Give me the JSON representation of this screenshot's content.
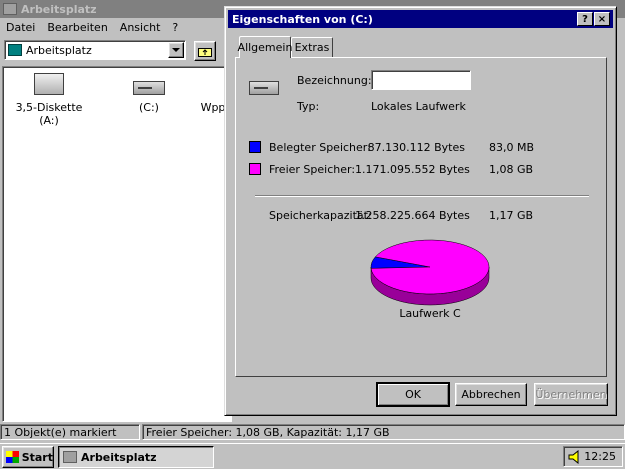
{
  "explorer": {
    "title": "Arbeitsplatz",
    "menu": [
      "Datei",
      "Bearbeiten",
      "Ansicht",
      "?"
    ],
    "address": "Arbeitsplatz",
    "items": [
      {
        "label": "3,5-Diskette (A:)",
        "icon": "floppy-drive-icon"
      },
      {
        "label": "(C:)",
        "icon": "hard-drive-icon"
      },
      {
        "label": "Wpp",
        "icon": "hard-drive-icon"
      }
    ],
    "status": {
      "left": "1 Objekt(e) markiert",
      "right": "Freier Speicher: 1,08 GB, Kapazität: 1,17 GB"
    }
  },
  "dialog": {
    "title": "Eigenschaften von  (C:)",
    "help_btn": "?",
    "close_btn": "×",
    "tabs": [
      "Allgemein",
      "Extras"
    ],
    "label_name": "Bezeichnung:",
    "name_value": "",
    "label_type": "Typ:",
    "type_value": "Lokales Laufwerk",
    "used": {
      "label": "Belegter Speicher:",
      "bytes": "87.130.112 Bytes",
      "size": "83,0 MB",
      "color": "#0000ff"
    },
    "free": {
      "label": "Freier Speicher:",
      "bytes": "1.171.095.552 Bytes",
      "size": "1,08 GB",
      "color": "#ff00ff"
    },
    "capacity": {
      "label": "Speicherkapazität:",
      "bytes": "1.258.225.664 Bytes",
      "size": "1,17 GB"
    },
    "drive_caption": "Laufwerk C",
    "buttons": {
      "ok": "OK",
      "cancel": "Abbrechen",
      "apply": "Übernehmen"
    }
  },
  "chart_data": {
    "type": "pie",
    "categories": [
      "Belegter Speicher",
      "Freier Speicher"
    ],
    "values": [
      87130112,
      1171095552
    ],
    "colors": [
      "#0000ff",
      "#ff00ff"
    ]
  },
  "taskbar": {
    "start": "Start",
    "task": "Arbeitsplatz",
    "clock": "12:25"
  }
}
